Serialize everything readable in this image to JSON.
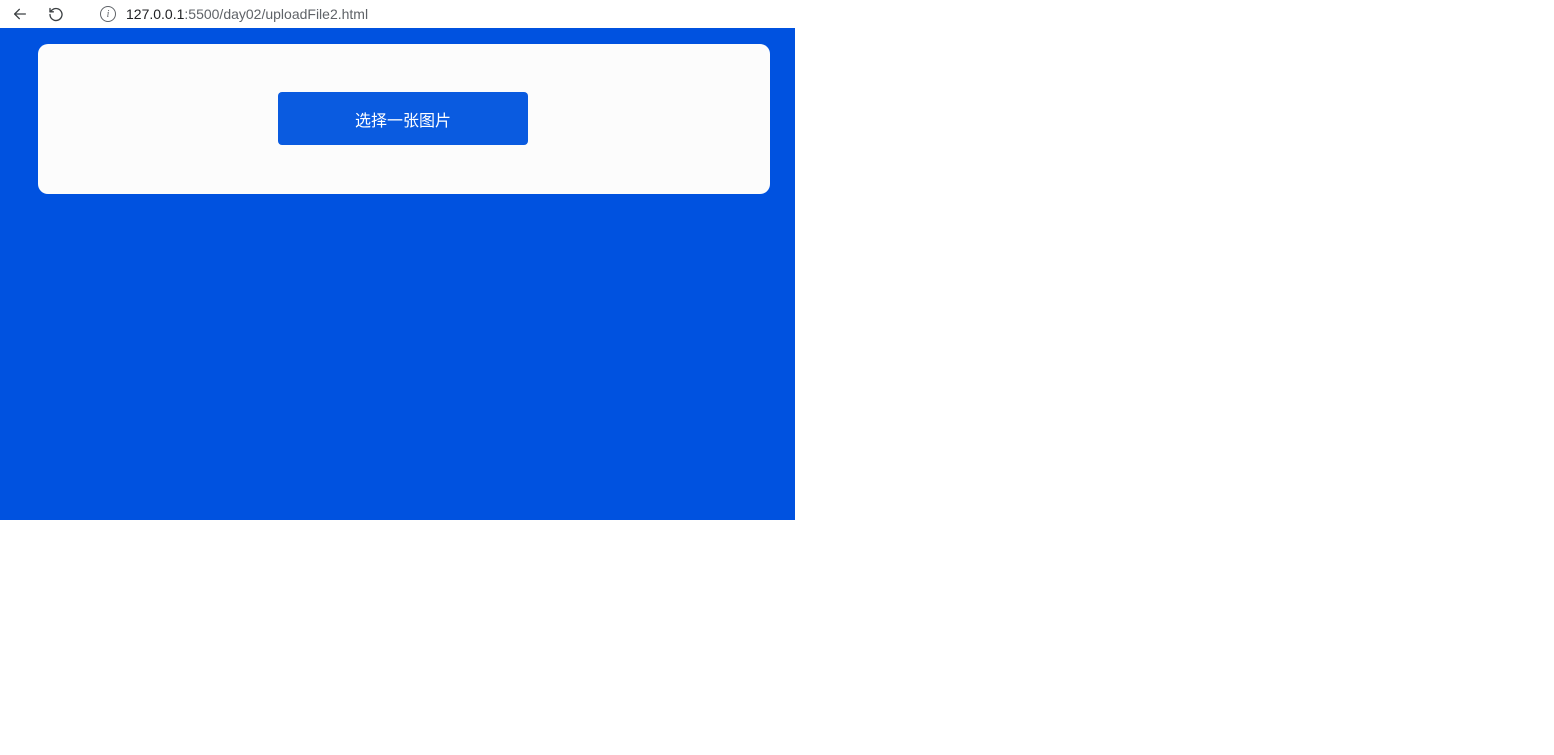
{
  "browser": {
    "url_host": "127.0.0.1",
    "url_path": ":5500/day02/uploadFile2.html"
  },
  "page": {
    "upload_button_label": "选择一张图片"
  }
}
